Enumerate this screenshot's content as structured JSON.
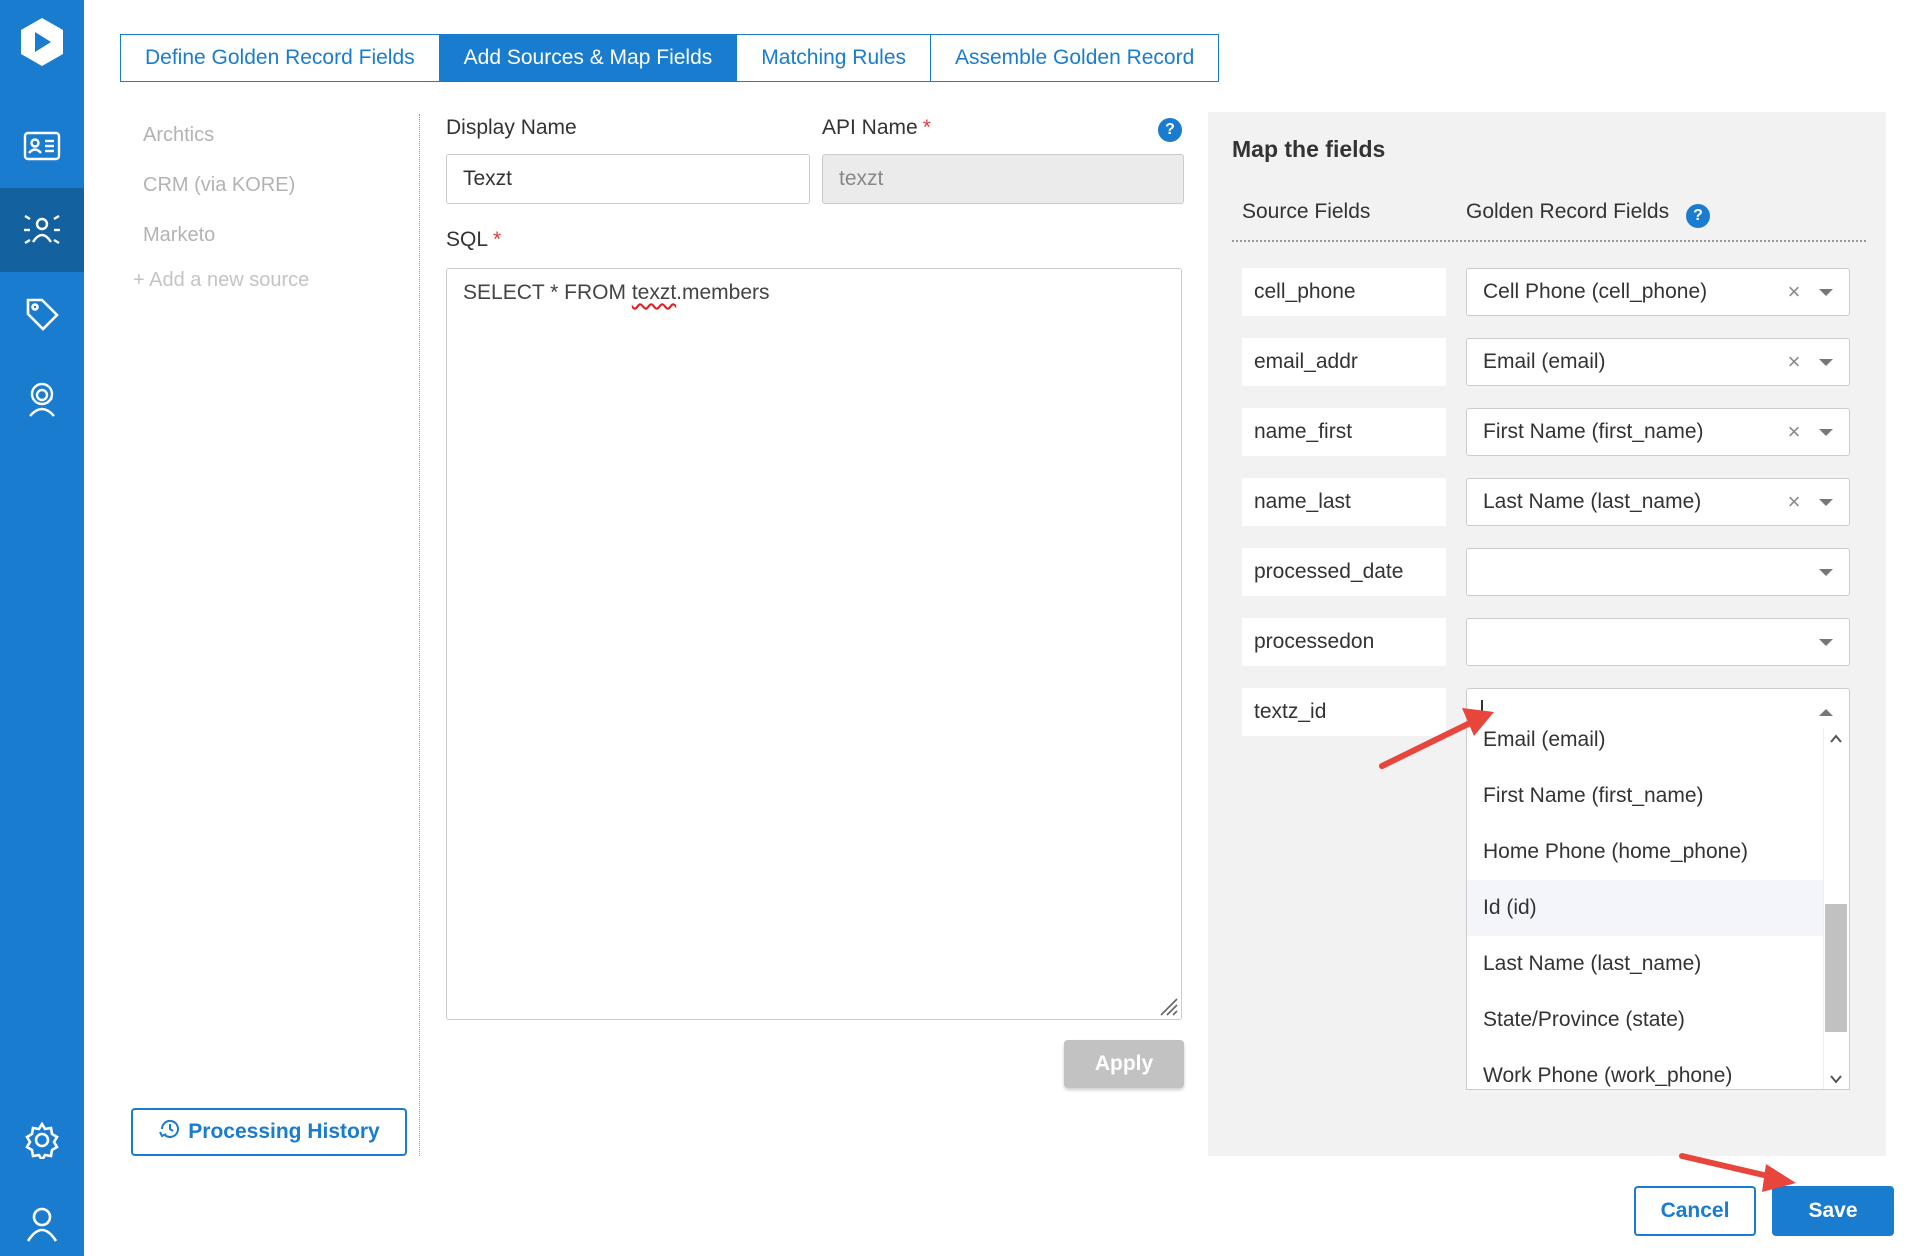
{
  "nav": {
    "icons": [
      "logo-icon",
      "contact-card-icon",
      "matching-icon",
      "tag-icon",
      "support-agent-icon",
      "settings-icon",
      "user-icon"
    ],
    "active": "matching-icon"
  },
  "tabs": [
    {
      "label": "Define Golden Record Fields",
      "active": false
    },
    {
      "label": "Add Sources & Map Fields",
      "active": true
    },
    {
      "label": "Matching Rules",
      "active": false
    },
    {
      "label": "Assemble Golden Record",
      "active": false
    }
  ],
  "sources": {
    "items": [
      "Archtics",
      "CRM (via KORE)",
      "Marketo"
    ],
    "add_label": "+ Add a new source",
    "history_label": "Processing History"
  },
  "form": {
    "display_name_label": "Display Name",
    "display_name_value": "Texzt",
    "api_name_label": "API Name",
    "api_name_value": "texzt",
    "required_mark": "*",
    "help": "?",
    "sql_label": "SQL",
    "sql_prefix": "SELECT * FROM ",
    "sql_misspelled": "texzt",
    "sql_suffix": ".members",
    "apply_label": "Apply"
  },
  "map": {
    "title": "Map the fields",
    "source_col": "Source Fields",
    "golden_col": "Golden Record Fields",
    "help": "?",
    "clear_glyph": "×",
    "rows": [
      {
        "source": "cell_phone",
        "target": "Cell Phone (cell_phone)"
      },
      {
        "source": "email_addr",
        "target": "Email (email)"
      },
      {
        "source": "name_first",
        "target": "First Name (first_name)"
      },
      {
        "source": "name_last",
        "target": "Last Name (last_name)"
      },
      {
        "source": "processed_date",
        "target": ""
      },
      {
        "source": "processedon",
        "target": ""
      },
      {
        "source": "textz_id",
        "target": ""
      }
    ],
    "dropdown_options": [
      "Email (email)",
      "First Name (first_name)",
      "Home Phone (home_phone)",
      "Id (id)",
      "Last Name (last_name)",
      "State/Province (state)",
      "Work Phone (work_phone)"
    ],
    "dropdown_hovered": "Id (id)"
  },
  "footer": {
    "cancel_label": "Cancel",
    "save_label": "Save"
  },
  "colors": {
    "brand": "#1a7ccf",
    "rail_active": "#14619f",
    "annotation_arrow": "#e8453c",
    "disabled_button": "#c2c2c2"
  }
}
